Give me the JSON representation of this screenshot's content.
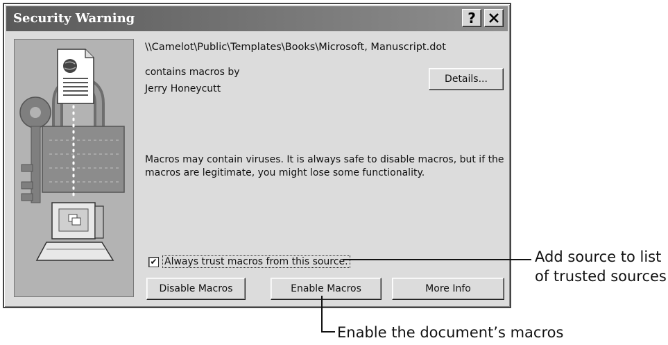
{
  "window": {
    "title": "Security Warning",
    "help_label": "?",
    "close_label": "✕"
  },
  "content": {
    "file_path": "\\\\Camelot\\Public\\Templates\\Books\\Microsoft, Manuscript.dot",
    "contains_label": "contains macros by",
    "author": "Jerry Honeycutt",
    "warning": "Macros may contain viruses. It is always safe to disable macros, but if the macros are legitimate, you might lose some functionality."
  },
  "buttons": {
    "details": "Details...",
    "disable": "Disable Macros",
    "enable": "Enable Macros",
    "more_info": "More Info"
  },
  "checkbox": {
    "label": "Always trust macros from this source.",
    "checked_mark": "✔"
  },
  "annotations": {
    "trust_line1": "Add source to list",
    "trust_line2": "of trusted sources",
    "enable_note": "Enable the document’s macros"
  },
  "icons": [
    "document-globe-icon",
    "padlock-icon",
    "keys-icon",
    "computer-icon"
  ]
}
